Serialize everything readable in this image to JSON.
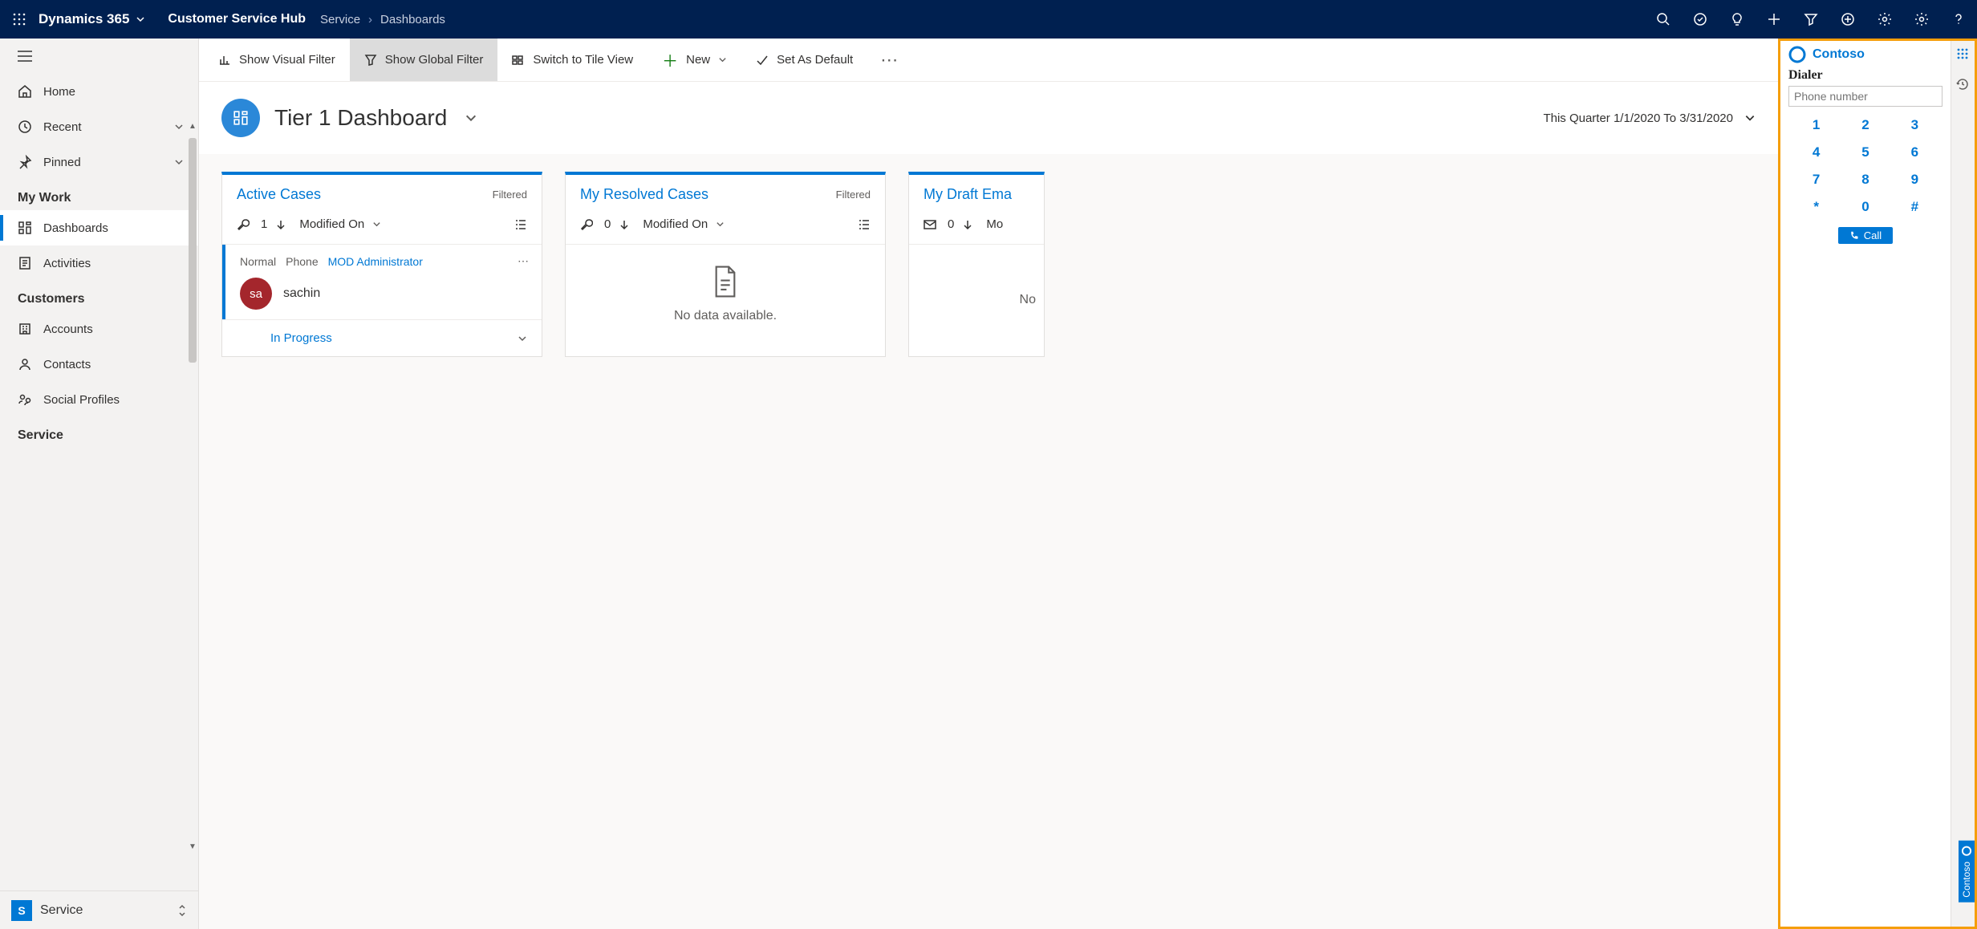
{
  "topbar": {
    "brand": "Dynamics 365",
    "app_name": "Customer Service Hub",
    "crumbs": [
      "Service",
      "Dashboards"
    ]
  },
  "commands": {
    "visual_filter": "Show Visual Filter",
    "global_filter": "Show Global Filter",
    "switch_tile": "Switch to Tile View",
    "new": "New",
    "set_default": "Set As Default"
  },
  "sidebar": {
    "home": "Home",
    "recent": "Recent",
    "pinned": "Pinned",
    "sections": {
      "my_work": "My Work",
      "customers": "Customers",
      "service": "Service"
    },
    "dashboards": "Dashboards",
    "activities": "Activities",
    "accounts": "Accounts",
    "contacts": "Contacts",
    "social_profiles": "Social Profiles",
    "area_letter": "S",
    "area_label": "Service"
  },
  "dashboard": {
    "title": "Tier 1 Dashboard",
    "date_range": "This Quarter 1/1/2020 To 3/31/2020"
  },
  "cards": {
    "active": {
      "title": "Active Cases",
      "filtered": "Filtered",
      "count": "1",
      "sort": "Modified On",
      "item": {
        "priority": "Normal",
        "origin": "Phone",
        "owner": "MOD Administrator",
        "avatar": "sa",
        "name": "sachin",
        "status": "In Progress"
      }
    },
    "resolved": {
      "title": "My Resolved Cases",
      "filtered": "Filtered",
      "count": "0",
      "sort": "Modified On",
      "no_data": "No data available."
    },
    "drafts": {
      "title": "My Draft Ema",
      "count": "0",
      "sort": "Mo",
      "no_data": "No"
    }
  },
  "dialer": {
    "brand": "Contoso",
    "title": "Dialer",
    "placeholder": "Phone number",
    "keys": [
      "1",
      "2",
      "3",
      "4",
      "5",
      "6",
      "7",
      "8",
      "9",
      "*",
      "0",
      "#"
    ],
    "call": "Call",
    "rail_tab": "Contoso"
  }
}
